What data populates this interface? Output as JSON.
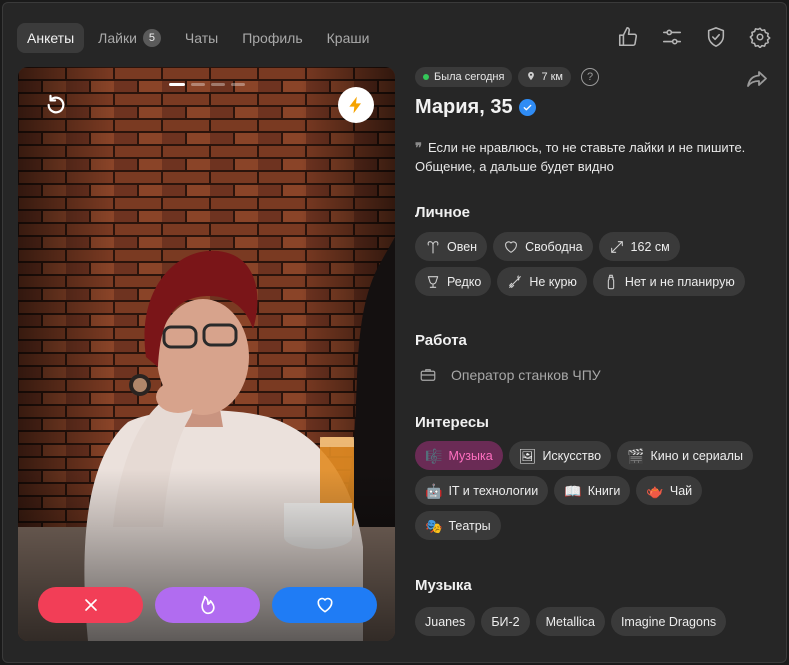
{
  "nav": {
    "tabs": [
      {
        "label": "Анкеты",
        "active": true
      },
      {
        "label": "Лайки",
        "count": "5"
      },
      {
        "label": "Чаты"
      },
      {
        "label": "Профиль"
      },
      {
        "label": "Краши"
      }
    ],
    "icons": [
      "thumbs-up-icon",
      "filters-icon",
      "shield-check-icon",
      "settings-gear-icon"
    ]
  },
  "photo": {
    "pages_total": 4,
    "page_active": 1,
    "buttons": [
      "undo-icon",
      "boost-lightning-icon"
    ],
    "actions": [
      "dislike-x-icon",
      "superlike-flame-icon",
      "like-heart-icon"
    ]
  },
  "profile": {
    "status": "Была сегодня",
    "distance": "7 км",
    "help": "?",
    "name": "Мария, 35",
    "verified": true,
    "bio": "Если не нравлюсь, то не ставьте лайки и не пишите. Общение, а дальше будет видно",
    "personal_title": "Личное",
    "personal": [
      {
        "label": "Овен",
        "icon": "zodiac-aries-icon"
      },
      {
        "label": "Свободна",
        "icon": "heart-outline-icon"
      },
      {
        "label": "162 см",
        "icon": "height-arrows-icon"
      },
      {
        "label": "Редко",
        "icon": "wine-glass-icon"
      },
      {
        "label": "Не курю",
        "icon": "no-smoking-icon"
      },
      {
        "label": "Нет и не планирую",
        "icon": "baby-bottle-icon"
      }
    ],
    "work_title": "Работа",
    "work": "Оператор станков ЧПУ",
    "interests_title": "Интересы",
    "interests": [
      {
        "label": "Музыка",
        "emoji": "🎼",
        "highlight": true
      },
      {
        "label": "Искусство",
        "emoji": "🖼️"
      },
      {
        "label": "Кино и сериалы",
        "emoji": "🎬"
      },
      {
        "label": "IT и технологии",
        "emoji": "🤖"
      },
      {
        "label": "Книги",
        "emoji": "📖"
      },
      {
        "label": "Чай",
        "emoji": "🫖"
      },
      {
        "label": "Театры",
        "emoji": "🎭"
      }
    ],
    "music_title": "Музыка",
    "music": [
      "Juanes",
      "БИ-2",
      "Metallica",
      "Imagine Dragons"
    ]
  },
  "colors": {
    "dislike": "#f23e57",
    "superlike": "#b16cf0",
    "like": "#1f7cf5",
    "online": "#34c759",
    "verified": "#2f8cf5",
    "interest_highlight": "#ff6fc0"
  }
}
